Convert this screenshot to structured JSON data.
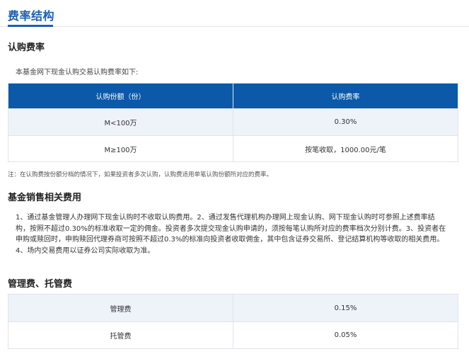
{
  "page_title": "费率结构",
  "subscription": {
    "heading": "认购费率",
    "intro": "本基金网下现金认购交易认购费率如下:",
    "columns": [
      "认购份额（份）",
      "认购费率"
    ],
    "rows": [
      [
        "M<100万",
        "0.30%"
      ],
      [
        "M≥100万",
        "按笔收取，1000.00元/笔"
      ]
    ],
    "note": "注：在认购费按份额分档的情况下，如果投资者多次认购，认购费适用单笔认购份额所对应的费率。"
  },
  "sales": {
    "heading": "基金销售相关费用",
    "text": "1、通过基金管理人办理网下现金认购时不收取认购费用。2、通过发售代理机构办理网上现金认购、网下现金认购时可参照上述费率结构，按照不超过0.30%的标准收取一定的佣金。投资者多次提交现金认购申请的，须按每笔认购所对应的费率档次分别计费。3、投资者在申购或赎回时，申购赎回代理券商可按照不超过0.3%的标准向投资者收取佣金，其中包含证券交易所、登记结算机构等收取的相关费用。4、场内交易费用以证券公司实际收取为准。"
  },
  "management": {
    "heading": "管理费、托管费",
    "rows": [
      [
        "管理费",
        "0.15%"
      ],
      [
        "托管费",
        "0.05%"
      ]
    ]
  },
  "colors": {
    "accent": "#1a5fb4",
    "header_bg": "#0b59a8",
    "row_alt_bg": "#eef2f9"
  }
}
